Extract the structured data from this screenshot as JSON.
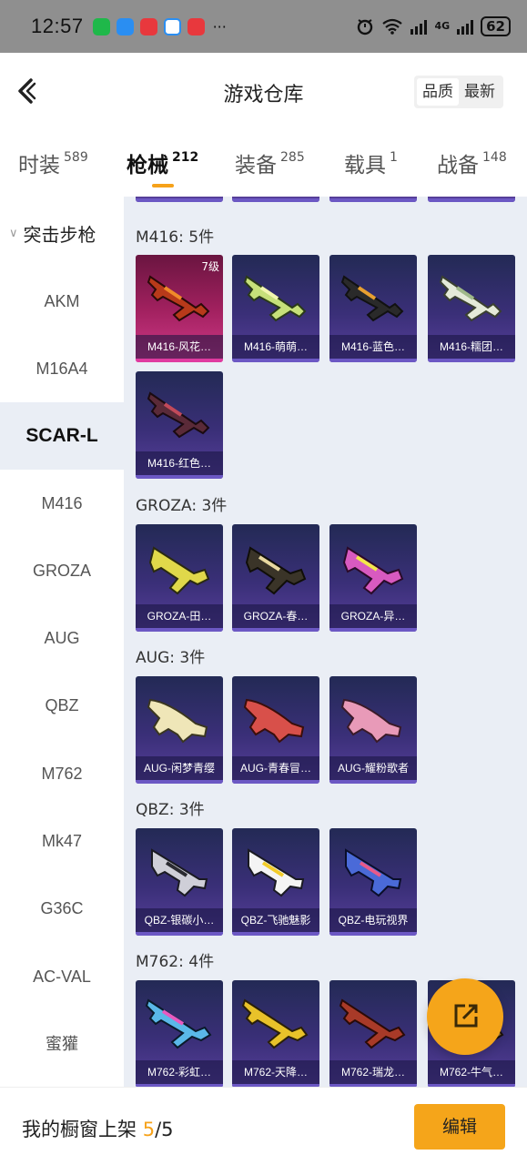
{
  "status_bar": {
    "time": "12:57",
    "network_label": "4G",
    "battery": "62"
  },
  "header": {
    "title": "游戏仓库",
    "sort_quality": "品质",
    "sort_latest": "最新"
  },
  "tabs": [
    {
      "label": "时装",
      "count": "589"
    },
    {
      "label": "枪械",
      "count": "212"
    },
    {
      "label": "装备",
      "count": "285"
    },
    {
      "label": "载具",
      "count": "1"
    },
    {
      "label": "战备",
      "count": "148"
    }
  ],
  "sidebar": {
    "category": "突击步枪",
    "items": [
      "AKM",
      "M16A4",
      "SCAR-L",
      "M416",
      "GROZA",
      "AUG",
      "QBZ",
      "M762",
      "Mk47",
      "G36C",
      "AC-VAL",
      "蜜獾"
    ]
  },
  "groups": [
    {
      "title": "M416: 5件",
      "items": [
        {
          "name": "M416-风花…",
          "level": "7级"
        },
        {
          "name": "M416-萌萌…"
        },
        {
          "name": "M416-蓝色…"
        },
        {
          "name": "M416-糯团…"
        },
        {
          "name": "M416-红色…"
        }
      ]
    },
    {
      "title": "GROZA: 3件",
      "items": [
        {
          "name": "GROZA-田…"
        },
        {
          "name": "GROZA-春…"
        },
        {
          "name": "GROZA-异…"
        }
      ]
    },
    {
      "title": "AUG: 3件",
      "items": [
        {
          "name": "AUG-闲梦青缨"
        },
        {
          "name": "AUG-青春冒…"
        },
        {
          "name": "AUG-耀粉歌者"
        }
      ]
    },
    {
      "title": "QBZ: 3件",
      "items": [
        {
          "name": "QBZ-银碳小…"
        },
        {
          "name": "QBZ-飞驰魅影"
        },
        {
          "name": "QBZ-电玩视界"
        }
      ]
    },
    {
      "title": "M762: 4件",
      "items": [
        {
          "name": "M762-彩虹…"
        },
        {
          "name": "M762-天降…"
        },
        {
          "name": "M762-瑞龙…"
        },
        {
          "name": "M762-牛气…"
        }
      ]
    }
  ],
  "bottom": {
    "label": "我的橱窗上架",
    "current": "5",
    "total": "/5",
    "edit": "编辑"
  },
  "colors": {
    "accent": "#f5a51a",
    "card_bg": "#3a2f78",
    "card_legendary": "#c2287a",
    "content_bg": "#eaeef5"
  }
}
